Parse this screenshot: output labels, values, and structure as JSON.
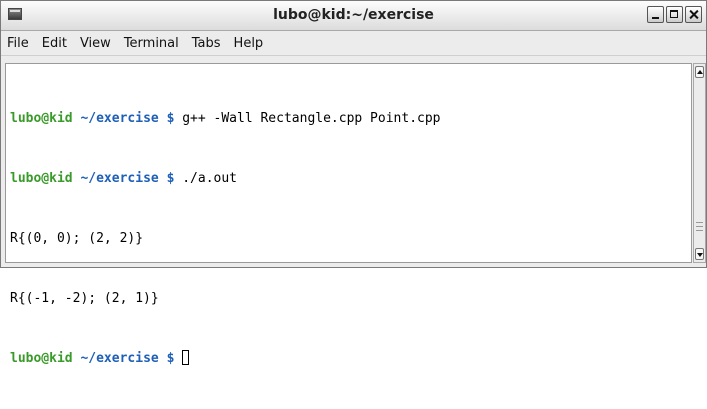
{
  "window": {
    "title": "lubo@kid:~/exercise"
  },
  "menu": [
    "File",
    "Edit",
    "View",
    "Terminal",
    "Tabs",
    "Help"
  ],
  "terminal": {
    "lines": [
      {
        "user": "lubo@kid",
        "path": "~/exercise",
        "prompt": "$",
        "command": "g++ -Wall Rectangle.cpp Point.cpp"
      },
      {
        "user": "lubo@kid",
        "path": "~/exercise",
        "prompt": "$",
        "command": "./a.out"
      },
      {
        "output": "R{(0, 0); (2, 2)}"
      },
      {
        "output": "R{(-1, -2); (2, 1)}"
      },
      {
        "user": "lubo@kid",
        "path": "~/exercise",
        "prompt": "$",
        "command": ""
      }
    ]
  },
  "icons": {
    "window": "terminal-window-icon",
    "minimize": "minimize-icon",
    "maximize": "maximize-icon",
    "close": "close-icon"
  }
}
